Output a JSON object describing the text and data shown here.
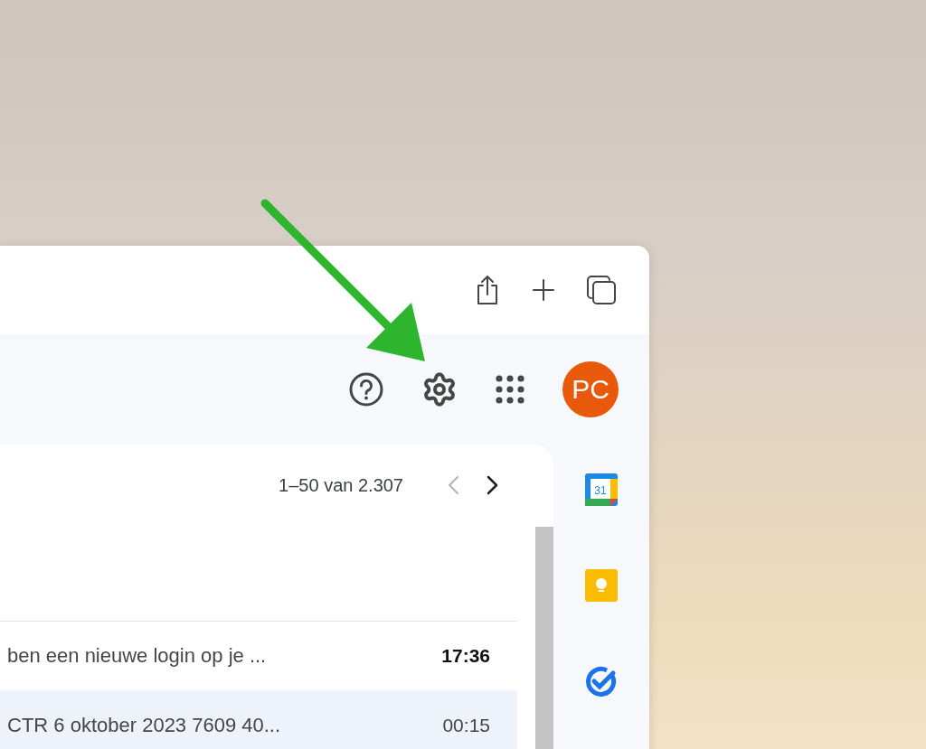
{
  "account": {
    "initials": "PC"
  },
  "pagination": {
    "range": "1–50 van 2.307",
    "prev_disabled": true,
    "next_disabled": false
  },
  "emails": [
    {
      "snippet": "ben een nieuwe login op je ...",
      "time": "17:36",
      "unread": true,
      "selected": false
    },
    {
      "snippet": "CTR 6 oktober 2023 7609 40...",
      "time": "00:15",
      "unread": false,
      "selected": true
    }
  ],
  "calendar": {
    "day": "31"
  }
}
